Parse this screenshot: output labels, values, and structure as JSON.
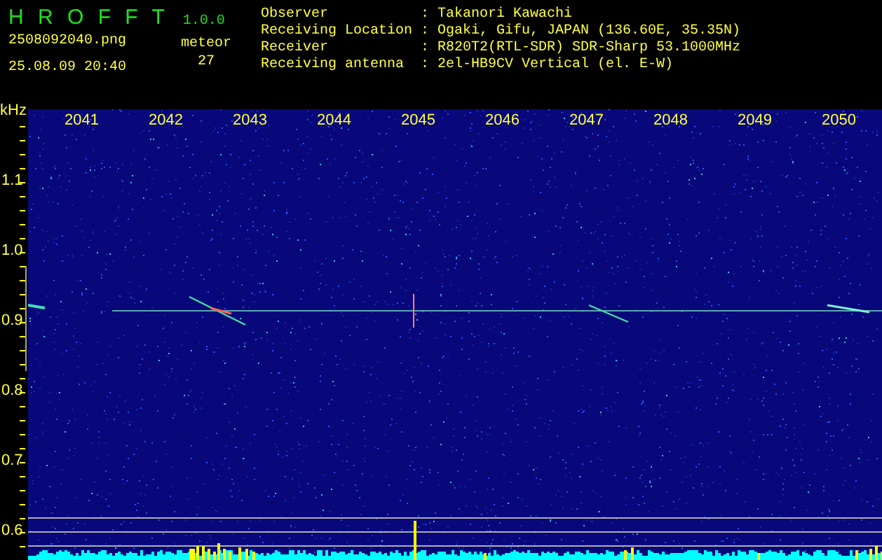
{
  "app": {
    "name": "H R O F F T",
    "version": "1.0.0"
  },
  "file_name": "2508092040.png",
  "timestamp": "25.08.09 20:40",
  "meteor": {
    "label": "meteor",
    "count": "27"
  },
  "station_info": [
    {
      "label": "Observer",
      "separator": ":",
      "value": "Takanori Kawachi"
    },
    {
      "label": "Receiving Location",
      "separator": ":",
      "value": "Ogaki, Gifu, JAPAN (136.60E, 35.35N)"
    },
    {
      "label": "Receiver",
      "separator": ":",
      "value": "R820T2(RTL-SDR) SDR-Sharp 53.1000MHz"
    },
    {
      "label": "Receiving antenna",
      "separator": ":",
      "value": "2el-HB9CV Vertical (el. E-W)"
    }
  ],
  "waterfall": {
    "y_unit": "kHz",
    "time_labels": [
      "2041",
      "2042",
      "2043",
      "2044",
      "2045",
      "2046",
      "2047",
      "2048",
      "2049",
      "2050"
    ],
    "frequency_labels": [
      "1.1",
      "1.0",
      "0.9",
      "0.8",
      "0.7",
      "0.6"
    ]
  }
}
